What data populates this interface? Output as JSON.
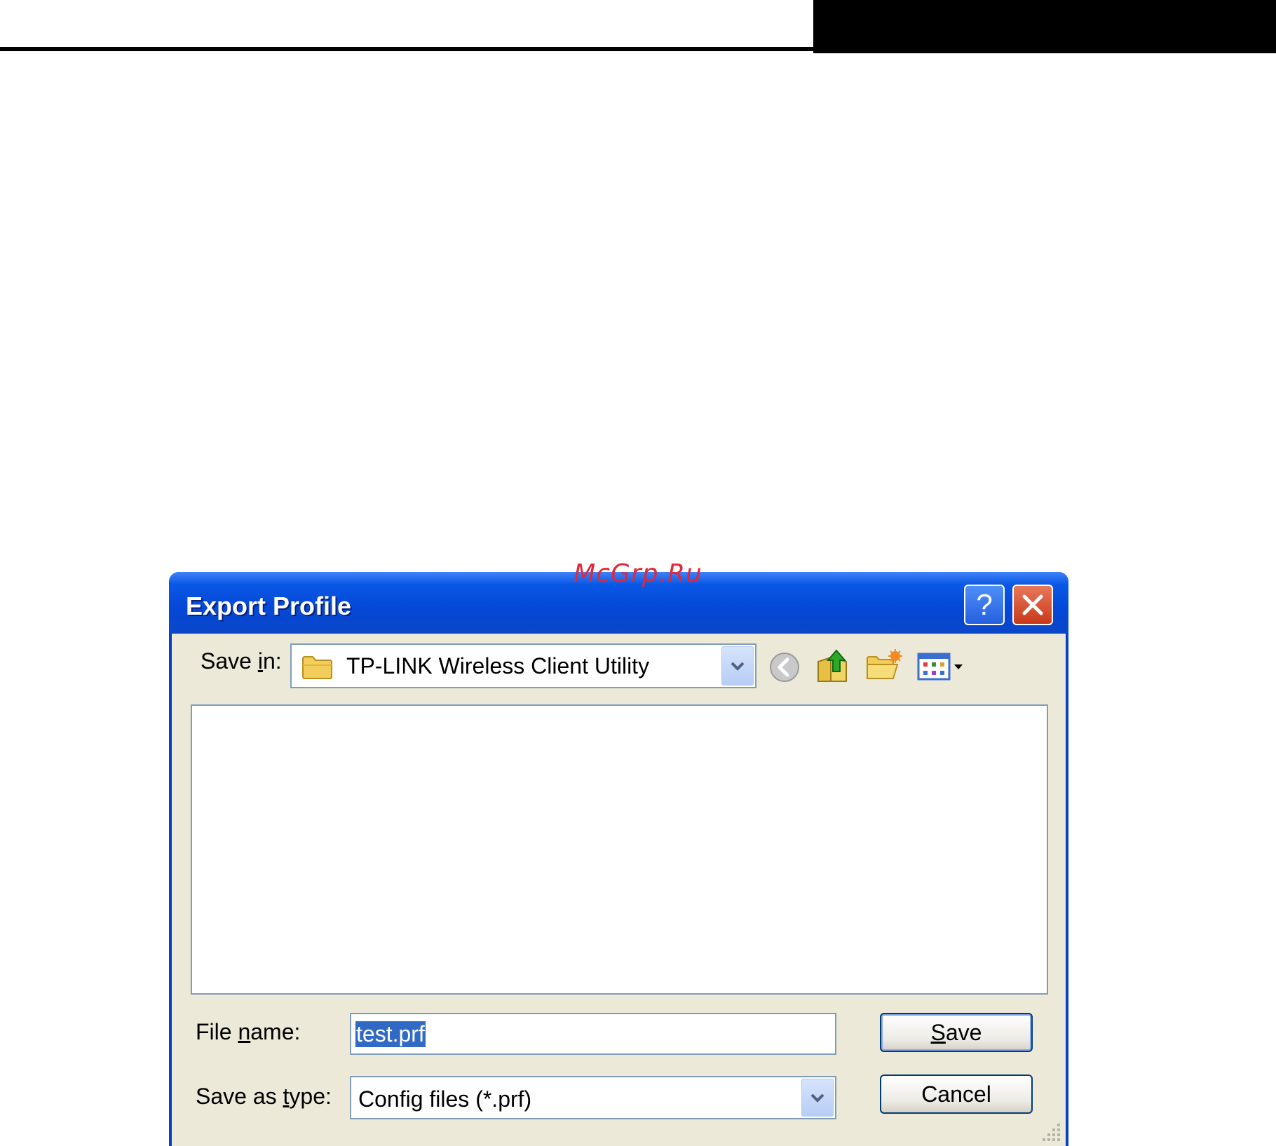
{
  "page": {
    "watermark": "McGrp.Ru"
  },
  "dialog": {
    "title": "Export Profile",
    "help_icon": "help-icon",
    "close_icon": "close-icon",
    "save_in": {
      "label_pre": "Save ",
      "label_accel": "i",
      "label_post": "n:",
      "value": "TP-LINK Wireless Client Utility",
      "icon": "folder-icon"
    },
    "toolbar": {
      "icons": [
        "back-icon",
        "up-folder-icon",
        "new-folder-icon",
        "view-menu-icon"
      ]
    },
    "file_name": {
      "label_pre": "File ",
      "label_accel": "n",
      "label_post": "ame:",
      "value": "test.prf"
    },
    "save_as_type": {
      "label_pre": "Save as ",
      "label_accel": "t",
      "label_post": "ype:",
      "value": "Config files (*.prf)"
    },
    "buttons": {
      "save_accel": "S",
      "save_rest": "ave",
      "cancel": "Cancel"
    },
    "colors": {
      "titlebar": "#0547d6",
      "client": "#ece9d8",
      "selection": "#316ac5",
      "watermark": "#e2273a"
    }
  }
}
